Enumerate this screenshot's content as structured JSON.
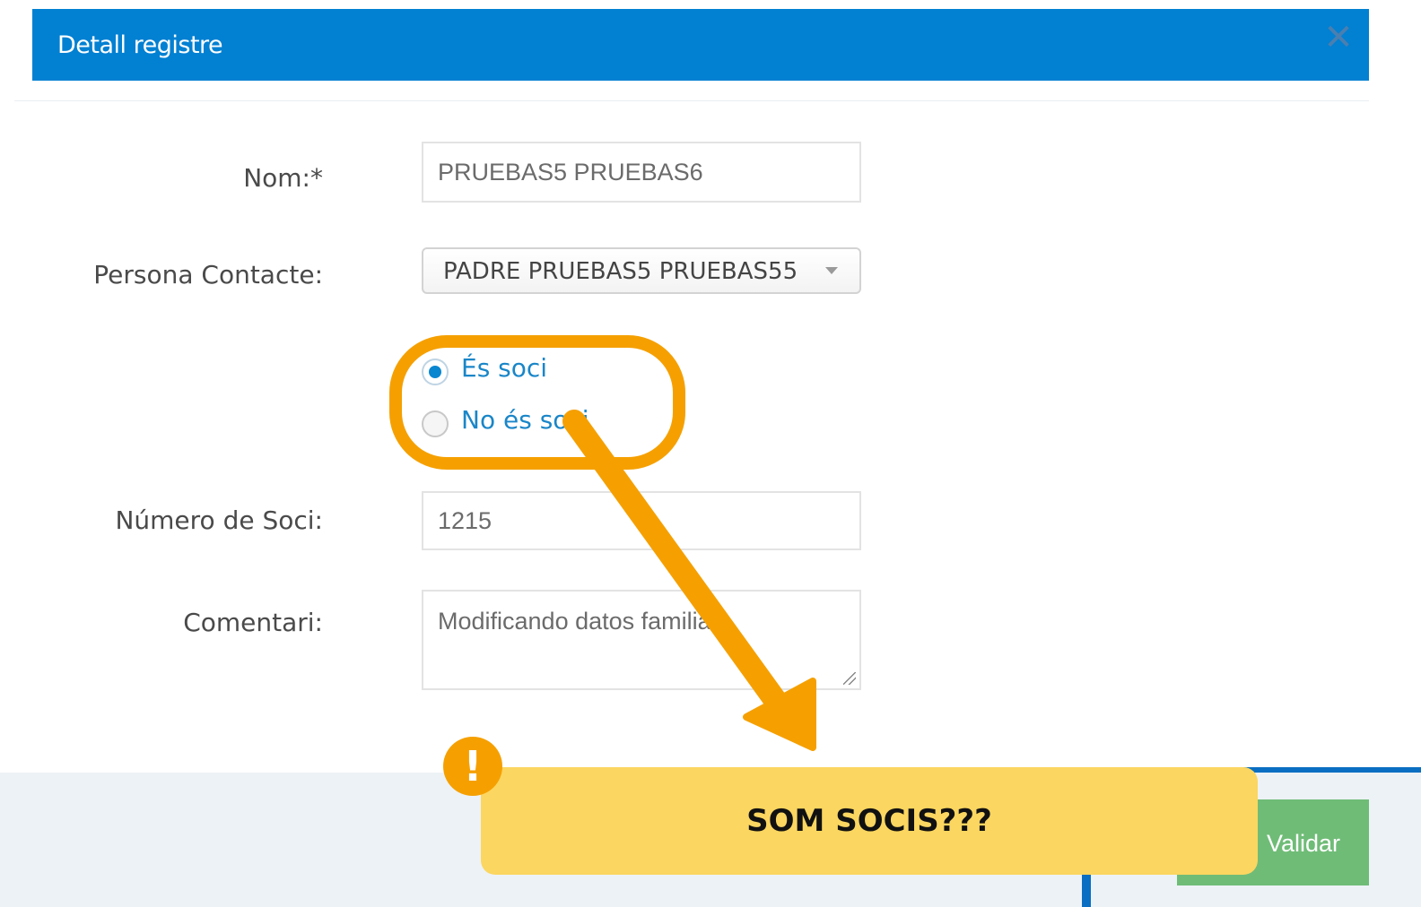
{
  "dialog": {
    "title": "Detall registre",
    "close_icon": "close-icon"
  },
  "form": {
    "name_label": "Nom:*",
    "name_value": "PRUEBAS5 PRUEBAS6",
    "contact_label": "Persona Contacte:",
    "contact_value": "PADRE PRUEBAS5 PRUEBAS55",
    "member_options": [
      {
        "label": "És soci",
        "checked": true
      },
      {
        "label": "No és soci",
        "checked": false
      }
    ],
    "member_number_label": "Número de Soci:",
    "member_number_value": "1215",
    "comment_label": "Comentari:",
    "comment_value": "Modificando datos familia"
  },
  "footer": {
    "validate_label": "Validar"
  },
  "annotation": {
    "note_text": "SOM SOCIS???",
    "note_icon": "!",
    "accent_color": "#f5a000",
    "note_color": "#fbd660"
  },
  "colors": {
    "header": "#0280d2",
    "link": "#1a86c8",
    "validate": "#6fbc77"
  }
}
